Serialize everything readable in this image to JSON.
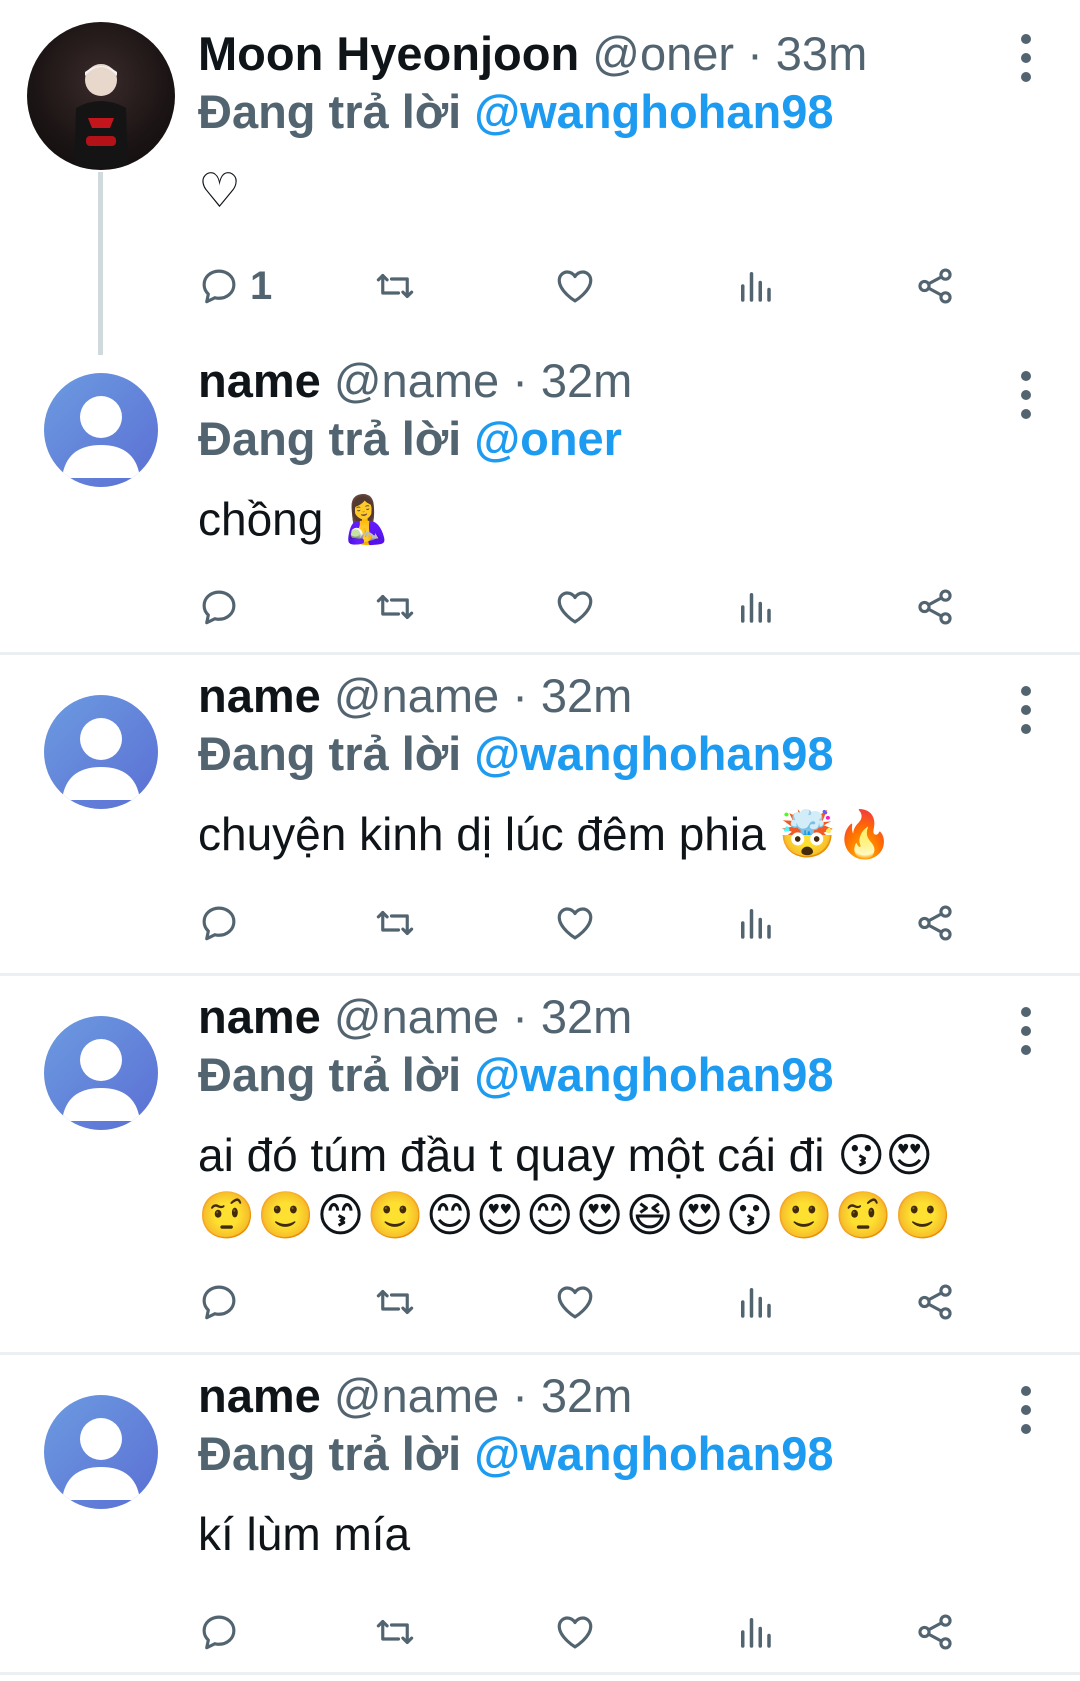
{
  "tweets": [
    {
      "name": "Moon Hyeonjoon",
      "handle": "@oner",
      "separator": "·",
      "time": "33m",
      "replying_label": "Đang trả lời",
      "replying_to": "@wanghohan98",
      "text": "♡",
      "reply_count": "1",
      "avatar": "photo"
    },
    {
      "name": "name",
      "handle": "@name",
      "separator": "·",
      "time": "32m",
      "replying_label": "Đang trả lời",
      "replying_to": "@oner",
      "text": "chồng 🤱",
      "avatar": "default"
    },
    {
      "name": "name",
      "handle": "@name",
      "separator": "·",
      "time": "32m",
      "replying_label": "Đang trả lời",
      "replying_to": "@wanghohan98",
      "text": "chuyện kinh dị lúc đêm phia 🤯🔥",
      "avatar": "default"
    },
    {
      "name": "name",
      "handle": "@name",
      "separator": "·",
      "time": "32m",
      "replying_label": "Đang trả lời",
      "replying_to": "@wanghohan98",
      "text": "ai đó túm đầu t quay một cái đi 😗😍",
      "text_line2": "🤨🙂😙🙂😊😍😊😍😆😍😗🙂🤨🙂",
      "avatar": "default"
    },
    {
      "name": "name",
      "handle": "@name",
      "separator": "·",
      "time": "32m",
      "replying_label": "Đang trả lời",
      "replying_to": "@wanghohan98",
      "text": "kí lùm mía",
      "avatar": "default"
    }
  ],
  "icons": {
    "reply": "reply-icon",
    "retweet": "retweet-icon",
    "like": "like-icon",
    "views": "views-icon",
    "share": "share-icon",
    "more": "more-options-icon"
  },
  "colors": {
    "mention": "#1d9bf0",
    "muted": "#536471",
    "text": "#0f1419",
    "divider": "#eceff1",
    "avatar_default": "#6c8fe0"
  }
}
